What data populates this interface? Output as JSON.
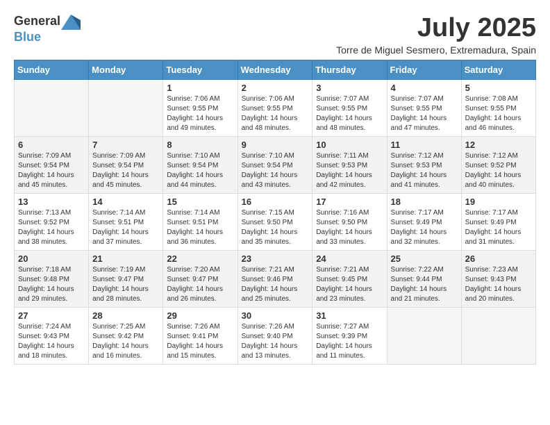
{
  "header": {
    "logo": {
      "text_general": "General",
      "text_blue": "Blue"
    },
    "month_title": "July 2025",
    "location": "Torre de Miguel Sesmero, Extremadura, Spain"
  },
  "calendar": {
    "days_of_week": [
      "Sunday",
      "Monday",
      "Tuesday",
      "Wednesday",
      "Thursday",
      "Friday",
      "Saturday"
    ],
    "weeks": [
      [
        {
          "day": "",
          "sunrise": "",
          "sunset": "",
          "daylight": ""
        },
        {
          "day": "",
          "sunrise": "",
          "sunset": "",
          "daylight": ""
        },
        {
          "day": "1",
          "sunrise": "Sunrise: 7:06 AM",
          "sunset": "Sunset: 9:55 PM",
          "daylight": "Daylight: 14 hours and 49 minutes."
        },
        {
          "day": "2",
          "sunrise": "Sunrise: 7:06 AM",
          "sunset": "Sunset: 9:55 PM",
          "daylight": "Daylight: 14 hours and 48 minutes."
        },
        {
          "day": "3",
          "sunrise": "Sunrise: 7:07 AM",
          "sunset": "Sunset: 9:55 PM",
          "daylight": "Daylight: 14 hours and 48 minutes."
        },
        {
          "day": "4",
          "sunrise": "Sunrise: 7:07 AM",
          "sunset": "Sunset: 9:55 PM",
          "daylight": "Daylight: 14 hours and 47 minutes."
        },
        {
          "day": "5",
          "sunrise": "Sunrise: 7:08 AM",
          "sunset": "Sunset: 9:55 PM",
          "daylight": "Daylight: 14 hours and 46 minutes."
        }
      ],
      [
        {
          "day": "6",
          "sunrise": "Sunrise: 7:09 AM",
          "sunset": "Sunset: 9:54 PM",
          "daylight": "Daylight: 14 hours and 45 minutes."
        },
        {
          "day": "7",
          "sunrise": "Sunrise: 7:09 AM",
          "sunset": "Sunset: 9:54 PM",
          "daylight": "Daylight: 14 hours and 45 minutes."
        },
        {
          "day": "8",
          "sunrise": "Sunrise: 7:10 AM",
          "sunset": "Sunset: 9:54 PM",
          "daylight": "Daylight: 14 hours and 44 minutes."
        },
        {
          "day": "9",
          "sunrise": "Sunrise: 7:10 AM",
          "sunset": "Sunset: 9:54 PM",
          "daylight": "Daylight: 14 hours and 43 minutes."
        },
        {
          "day": "10",
          "sunrise": "Sunrise: 7:11 AM",
          "sunset": "Sunset: 9:53 PM",
          "daylight": "Daylight: 14 hours and 42 minutes."
        },
        {
          "day": "11",
          "sunrise": "Sunrise: 7:12 AM",
          "sunset": "Sunset: 9:53 PM",
          "daylight": "Daylight: 14 hours and 41 minutes."
        },
        {
          "day": "12",
          "sunrise": "Sunrise: 7:12 AM",
          "sunset": "Sunset: 9:52 PM",
          "daylight": "Daylight: 14 hours and 40 minutes."
        }
      ],
      [
        {
          "day": "13",
          "sunrise": "Sunrise: 7:13 AM",
          "sunset": "Sunset: 9:52 PM",
          "daylight": "Daylight: 14 hours and 38 minutes."
        },
        {
          "day": "14",
          "sunrise": "Sunrise: 7:14 AM",
          "sunset": "Sunset: 9:51 PM",
          "daylight": "Daylight: 14 hours and 37 minutes."
        },
        {
          "day": "15",
          "sunrise": "Sunrise: 7:14 AM",
          "sunset": "Sunset: 9:51 PM",
          "daylight": "Daylight: 14 hours and 36 minutes."
        },
        {
          "day": "16",
          "sunrise": "Sunrise: 7:15 AM",
          "sunset": "Sunset: 9:50 PM",
          "daylight": "Daylight: 14 hours and 35 minutes."
        },
        {
          "day": "17",
          "sunrise": "Sunrise: 7:16 AM",
          "sunset": "Sunset: 9:50 PM",
          "daylight": "Daylight: 14 hours and 33 minutes."
        },
        {
          "day": "18",
          "sunrise": "Sunrise: 7:17 AM",
          "sunset": "Sunset: 9:49 PM",
          "daylight": "Daylight: 14 hours and 32 minutes."
        },
        {
          "day": "19",
          "sunrise": "Sunrise: 7:17 AM",
          "sunset": "Sunset: 9:49 PM",
          "daylight": "Daylight: 14 hours and 31 minutes."
        }
      ],
      [
        {
          "day": "20",
          "sunrise": "Sunrise: 7:18 AM",
          "sunset": "Sunset: 9:48 PM",
          "daylight": "Daylight: 14 hours and 29 minutes."
        },
        {
          "day": "21",
          "sunrise": "Sunrise: 7:19 AM",
          "sunset": "Sunset: 9:47 PM",
          "daylight": "Daylight: 14 hours and 28 minutes."
        },
        {
          "day": "22",
          "sunrise": "Sunrise: 7:20 AM",
          "sunset": "Sunset: 9:47 PM",
          "daylight": "Daylight: 14 hours and 26 minutes."
        },
        {
          "day": "23",
          "sunrise": "Sunrise: 7:21 AM",
          "sunset": "Sunset: 9:46 PM",
          "daylight": "Daylight: 14 hours and 25 minutes."
        },
        {
          "day": "24",
          "sunrise": "Sunrise: 7:21 AM",
          "sunset": "Sunset: 9:45 PM",
          "daylight": "Daylight: 14 hours and 23 minutes."
        },
        {
          "day": "25",
          "sunrise": "Sunrise: 7:22 AM",
          "sunset": "Sunset: 9:44 PM",
          "daylight": "Daylight: 14 hours and 21 minutes."
        },
        {
          "day": "26",
          "sunrise": "Sunrise: 7:23 AM",
          "sunset": "Sunset: 9:43 PM",
          "daylight": "Daylight: 14 hours and 20 minutes."
        }
      ],
      [
        {
          "day": "27",
          "sunrise": "Sunrise: 7:24 AM",
          "sunset": "Sunset: 9:43 PM",
          "daylight": "Daylight: 14 hours and 18 minutes."
        },
        {
          "day": "28",
          "sunrise": "Sunrise: 7:25 AM",
          "sunset": "Sunset: 9:42 PM",
          "daylight": "Daylight: 14 hours and 16 minutes."
        },
        {
          "day": "29",
          "sunrise": "Sunrise: 7:26 AM",
          "sunset": "Sunset: 9:41 PM",
          "daylight": "Daylight: 14 hours and 15 minutes."
        },
        {
          "day": "30",
          "sunrise": "Sunrise: 7:26 AM",
          "sunset": "Sunset: 9:40 PM",
          "daylight": "Daylight: 14 hours and 13 minutes."
        },
        {
          "day": "31",
          "sunrise": "Sunrise: 7:27 AM",
          "sunset": "Sunset: 9:39 PM",
          "daylight": "Daylight: 14 hours and 11 minutes."
        },
        {
          "day": "",
          "sunrise": "",
          "sunset": "",
          "daylight": ""
        },
        {
          "day": "",
          "sunrise": "",
          "sunset": "",
          "daylight": ""
        }
      ]
    ]
  }
}
